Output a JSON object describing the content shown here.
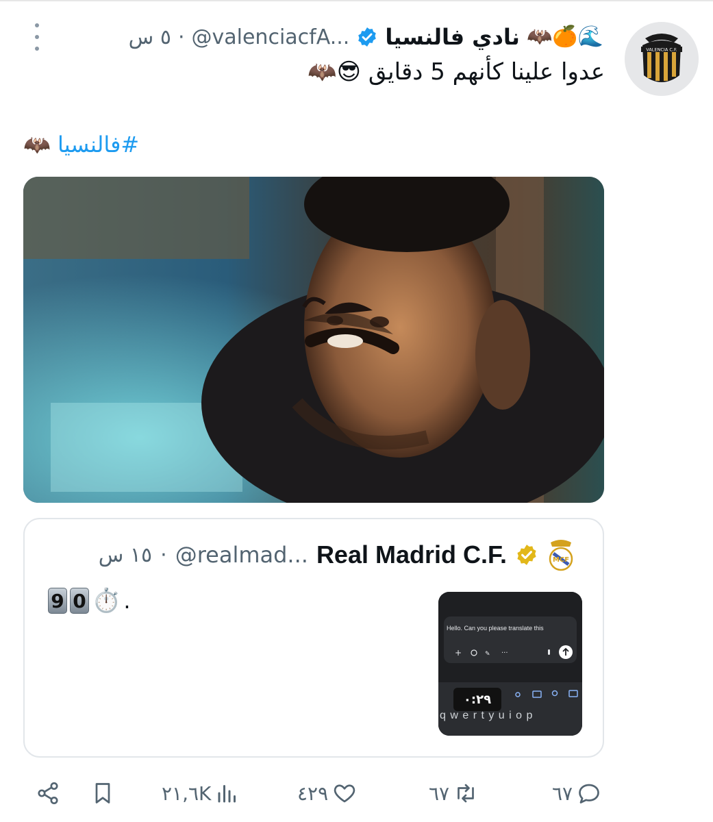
{
  "tweet": {
    "author_emojis": "🦇🍊🌊",
    "author_name": "نادي فالنسيا",
    "handle": "@valenciacfA...",
    "dot": "·",
    "time": "٥ س",
    "text": "عدوا علينا كأنهم 5 دقايق 😎🦇",
    "hashtag_line": "#فالنسيا 🦇",
    "avatar_text": "VALENCIA C.F.",
    "media_description_icon": "photo"
  },
  "quote": {
    "author_name": "Real Madrid C.F.",
    "handle": "@realmad...",
    "dot": "·",
    "time": "١٥ س",
    "keycaps": [
      "9",
      "0"
    ],
    "stopwatch": "⏱️",
    "period": ".",
    "thumb_prompt": "Hello. Can you please translate this",
    "thumb_timer": "٠:٢٩",
    "thumb_keys": "q w e r t y u i o p"
  },
  "actions": {
    "replies": "٦٧",
    "retweets": "٦٧",
    "likes": "٤٢٩",
    "views": "٢١,٦K"
  },
  "colors": {
    "link": "#1d9bf0",
    "verified_blue": "#1d9bf0",
    "verified_gold": "#e2b719",
    "muted": "#536471"
  }
}
